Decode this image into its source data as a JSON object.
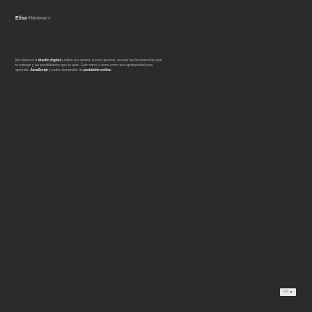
{
  "site": {
    "title_first": "Elisa",
    "title_rest": "Honora",
    "title_fade": "to"
  },
  "intro": {
    "t1": "Me interesa el ",
    "b1": "diseño digital",
    "t2": " y todas sus aristas. A nivel general, rescato las herramientas que te entrega y las posibilidades que te abre. Este ramo lo tomo como una oportunidad para aprender ",
    "b2": "JavaScript",
    "t3": " y poder desarrollar mi ",
    "b3": "portafolio online."
  },
  "language_button": {
    "label": "ES",
    "icon": "chevron-down-icon"
  }
}
